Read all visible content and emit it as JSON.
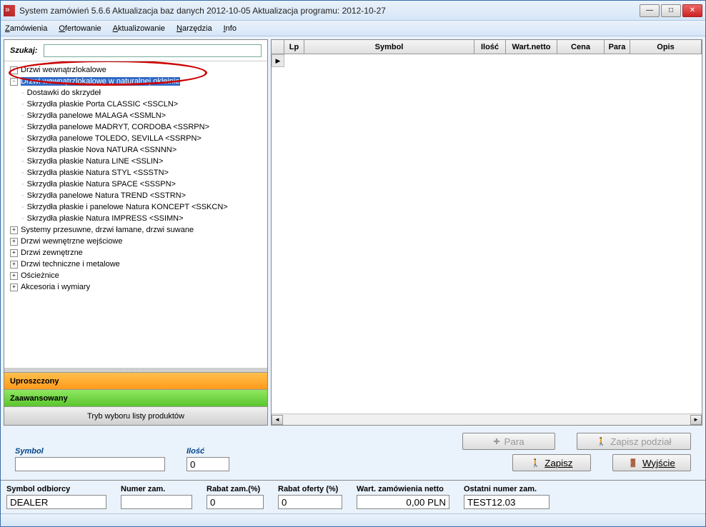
{
  "title": "System zamówień 5.6.6  Aktualizacja baz danych 2012-10-05  Aktualizacja programu: 2012-10-27",
  "menu": {
    "zamowienia": "Zamówienia",
    "ofertowanie": "Ofertowanie",
    "aktualizowanie": "Aktualizowanie",
    "narzedzia": "Narzędzia",
    "info": "Info"
  },
  "search": {
    "label": "Szukaj:",
    "value": ""
  },
  "tree": {
    "items": [
      {
        "label": "Drzwi wewnątrzlokalowe",
        "level": 0,
        "expand": "+",
        "selected": false
      },
      {
        "label": "Drzwi wewnątrzlokalowe w naturalnej okleinie",
        "level": 0,
        "expand": "-",
        "selected": true
      },
      {
        "label": "Dostawki do skrzydeł",
        "level": 1,
        "leaf": true
      },
      {
        "label": "Skrzydła płaskie Porta CLASSIC <SSCLN>",
        "level": 1,
        "leaf": true
      },
      {
        "label": "Skrzydła panelowe MALAGA <SSMLN>",
        "level": 1,
        "leaf": true
      },
      {
        "label": "Skrzydła panelowe MADRYT, CORDOBA <SSRPN>",
        "level": 1,
        "leaf": true
      },
      {
        "label": "Skrzydła panelowe TOLEDO, SEVILLA <SSRPN>",
        "level": 1,
        "leaf": true
      },
      {
        "label": "Skrzydła płaskie Nova NATURA <SSNNN>",
        "level": 1,
        "leaf": true
      },
      {
        "label": "Skrzydła płaskie Natura LINE <SSLIN>",
        "level": 1,
        "leaf": true
      },
      {
        "label": "Skrzydła płaskie Natura STYL <SSSTN>",
        "level": 1,
        "leaf": true
      },
      {
        "label": "Skrzydła płaskie Natura SPACE <SSSPN>",
        "level": 1,
        "leaf": true
      },
      {
        "label": "Skrzydła panelowe Natura TREND <SSTRN>",
        "level": 1,
        "leaf": true
      },
      {
        "label": "Skrzydła płaskie i panelowe Natura KONCEPT <SSKCN>",
        "level": 1,
        "leaf": true
      },
      {
        "label": "Skrzydła płaskie Natura IMPRESS <SSIMN>",
        "level": 1,
        "leaf": true
      },
      {
        "label": "Systemy przesuwne, drzwi łamane, drzwi suwane",
        "level": 0,
        "expand": "+"
      },
      {
        "label": "Drzwi wewnętrzne wejściowe",
        "level": 0,
        "expand": "+"
      },
      {
        "label": "Drzwi zewnętrzne",
        "level": 0,
        "expand": "+"
      },
      {
        "label": "Drzwi techniczne i metalowe",
        "level": 0,
        "expand": "+"
      },
      {
        "label": "Ościeżnice",
        "level": 0,
        "expand": "+"
      },
      {
        "label": "Akcesoria i wymiary",
        "level": 0,
        "expand": "+"
      }
    ]
  },
  "modes": {
    "simple": "Uproszczony",
    "advanced": "Zaawansowany",
    "tryb": "Tryb wyboru listy produktów"
  },
  "grid": {
    "cols": {
      "lp": "Lp",
      "symbol": "Symbol",
      "ilosc": "Ilość",
      "wartnetto": "Wart.netto",
      "cena": "Cena",
      "para": "Para",
      "opis": "Opis"
    }
  },
  "form": {
    "symbol_label": "Symbol",
    "symbol_value": "",
    "ilosc_label": "Ilość",
    "ilosc_value": "0",
    "para_btn": "Para",
    "zapisz_podzial_btn": "Zapisz podział",
    "zapisz_btn": "Zapisz",
    "wyjscie_btn": "Wyjście"
  },
  "bottom": {
    "symbol_odbiorcy_label": "Symbol odbiorcy",
    "symbol_odbiorcy_value": "DEALER",
    "numer_zam_label": "Numer zam.",
    "numer_zam_value": "",
    "rabat_zam_label": "Rabat zam.(%)",
    "rabat_zam_value": "0",
    "rabat_oferty_label": "Rabat oferty (%)",
    "rabat_oferty_value": "0",
    "wart_label": "Wart. zamówienia netto",
    "wart_value": "0,00 PLN",
    "ostatni_label": "Ostatni numer zam.",
    "ostatni_value": "TEST12.03"
  }
}
